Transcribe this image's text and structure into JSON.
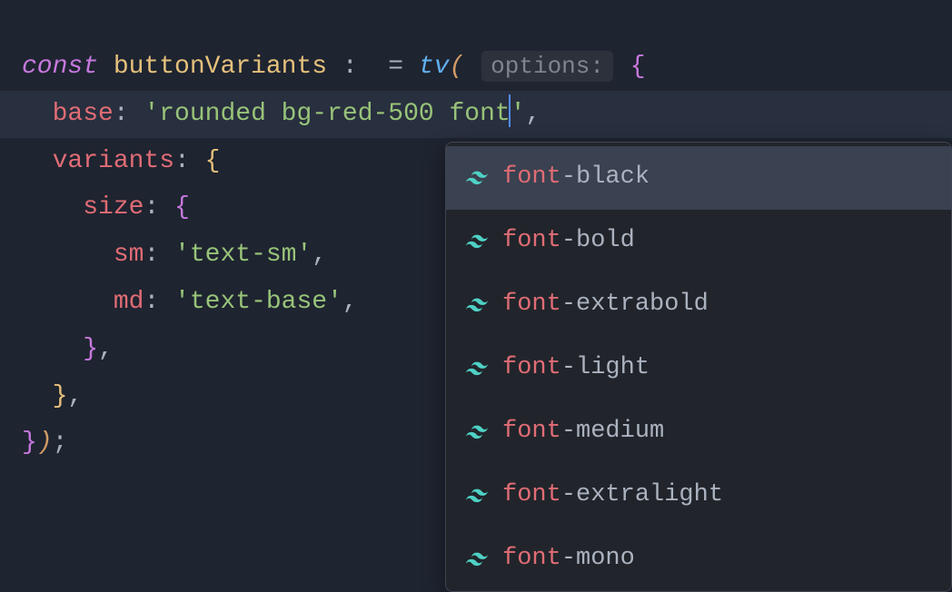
{
  "code": {
    "keyword_const": "const",
    "var_name": "buttonVariants",
    "colon_space": " :",
    "eq": "=",
    "func_name": "tv",
    "inlay_options": "options:",
    "brace_open": "{",
    "brace_close": "}",
    "paren_open": "(",
    "paren_close": ")",
    "semicolon": ";",
    "comma": ",",
    "prop_base": "base",
    "string_base": "'rounded bg-red-500 font",
    "string_closequote": "'",
    "prop_variants": "variants",
    "prop_size": "size",
    "prop_sm": "sm",
    "string_sm": "'text-sm'",
    "prop_md": "md",
    "string_md": "'text-base'"
  },
  "autocomplete": {
    "items": [
      {
        "prefix": "font",
        "suffix": "-black",
        "selected": true
      },
      {
        "prefix": "font",
        "suffix": "-bold",
        "selected": false
      },
      {
        "prefix": "font",
        "suffix": "-extrabold",
        "selected": false
      },
      {
        "prefix": "font",
        "suffix": "-light",
        "selected": false
      },
      {
        "prefix": "font",
        "suffix": "-medium",
        "selected": false
      },
      {
        "prefix": "font",
        "suffix": "-extralight",
        "selected": false
      },
      {
        "prefix": "font",
        "suffix": "-mono",
        "selected": false
      }
    ]
  }
}
